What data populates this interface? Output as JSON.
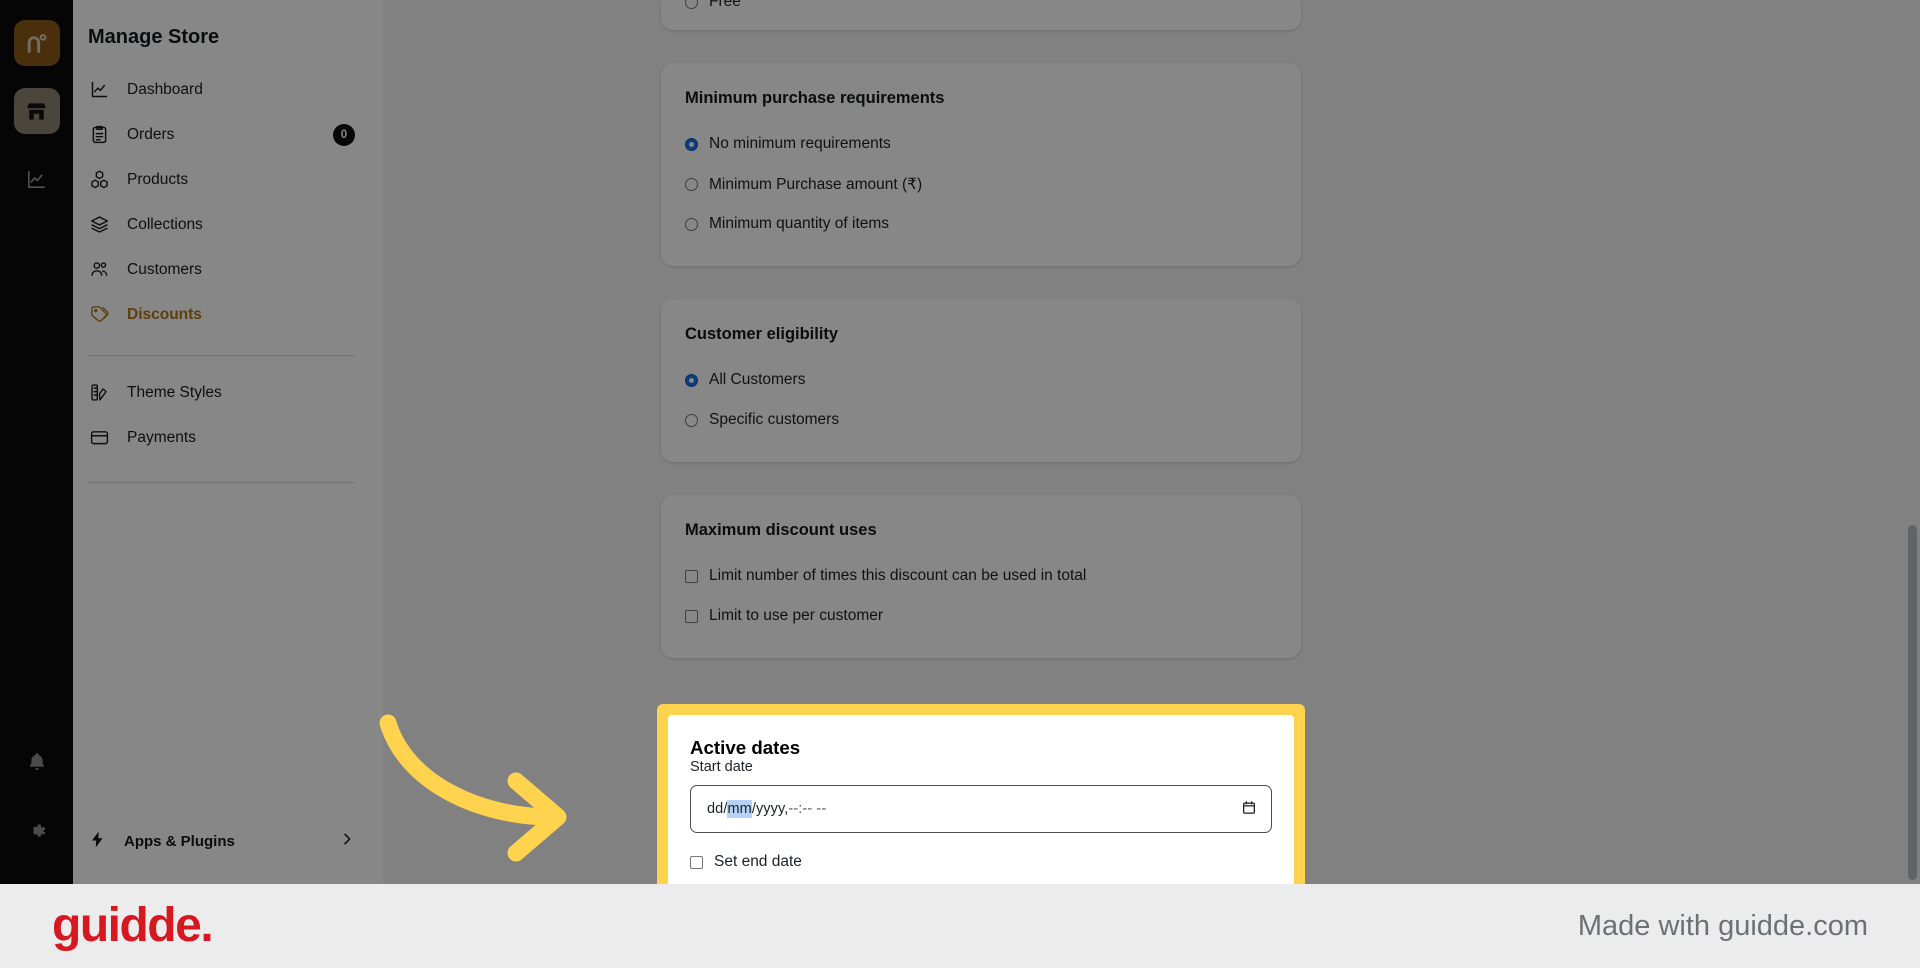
{
  "rail": {
    "logo_label": "n",
    "items": [
      {
        "name": "store-icon",
        "label": "Store",
        "active": true
      },
      {
        "name": "analytics-icon",
        "label": "Analytics",
        "active": false
      }
    ],
    "bottom": [
      {
        "name": "bell-icon",
        "label": "Notifications"
      },
      {
        "name": "gear-icon",
        "label": "Settings"
      }
    ]
  },
  "sidebar": {
    "title": "Manage Store",
    "items": [
      {
        "label": "Dashboard",
        "icon": "chart-line-icon",
        "badge": null,
        "active": false
      },
      {
        "label": "Orders",
        "icon": "clipboard-icon",
        "badge": "0",
        "active": false
      },
      {
        "label": "Products",
        "icon": "boxes-icon",
        "badge": null,
        "active": false
      },
      {
        "label": "Collections",
        "icon": "layers-icon",
        "badge": null,
        "active": false
      },
      {
        "label": "Customers",
        "icon": "users-icon",
        "badge": null,
        "active": false
      },
      {
        "label": "Discounts",
        "icon": "tag-icon",
        "badge": null,
        "active": true
      }
    ],
    "items_secondary": [
      {
        "label": "Theme Styles",
        "icon": "palette-icon",
        "badge": null,
        "active": false
      },
      {
        "label": "Payments",
        "icon": "wallet-icon",
        "badge": null,
        "active": false
      }
    ],
    "footer": {
      "label": "Apps & Plugins",
      "icon": "bolt-icon",
      "chevron": "chevron-right-icon"
    }
  },
  "main": {
    "card_clipped": {
      "partial_option": "Free"
    },
    "minimum_purchase": {
      "title": "Minimum purchase requirements",
      "options": [
        {
          "label": "No minimum requirements",
          "checked": true
        },
        {
          "label": "Minimum Purchase amount (₹)",
          "checked": false
        },
        {
          "label": "Minimum quantity of items",
          "checked": false
        }
      ]
    },
    "customer_eligibility": {
      "title": "Customer eligibility",
      "options": [
        {
          "label": "All Customers",
          "checked": true
        },
        {
          "label": "Specific customers",
          "checked": false
        }
      ]
    },
    "maximum_discount_uses": {
      "title": "Maximum discount uses",
      "options": [
        {
          "label": "Limit number of times this discount can be used in total",
          "checked": false
        },
        {
          "label": "Limit to use per customer",
          "checked": false
        }
      ]
    },
    "active_dates": {
      "title": "Active dates",
      "start_date_label": "Start date",
      "start_date_value_prefix": "dd/",
      "start_date_value_highlight": "mm",
      "start_date_value_suffix": "/yyyy, ",
      "start_date_value_time": "--:-- --",
      "calendar_icon": "calendar-icon",
      "set_end_date_label": "Set end date",
      "set_end_date_checked": false,
      "highlight_color": "#ffd34e"
    }
  },
  "footer": {
    "brand": "guidde.",
    "made_with": "Made with guidde.com",
    "brand_color": "#d61921"
  }
}
